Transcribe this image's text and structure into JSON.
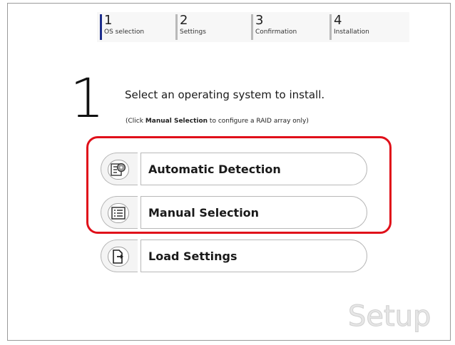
{
  "steps": [
    {
      "num": "1",
      "label": "OS selection"
    },
    {
      "num": "2",
      "label": "Settings"
    },
    {
      "num": "3",
      "label": "Confirmation"
    },
    {
      "num": "4",
      "label": "Installation"
    }
  ],
  "current_step": "1",
  "heading": "Select an operating system to install.",
  "hint": {
    "prefix": "(Click ",
    "strong": "Manual Selection",
    "suffix": " to configure a RAID array only)"
  },
  "options": [
    {
      "label": "Automatic Detection",
      "icon": "disc-detect-icon"
    },
    {
      "label": "Manual Selection",
      "icon": "list-icon"
    },
    {
      "label": "Load Settings",
      "icon": "load-file-icon"
    }
  ],
  "brand": "Setup",
  "colors": {
    "active_step": "#1e2e8c",
    "highlight": "#e0101a"
  }
}
